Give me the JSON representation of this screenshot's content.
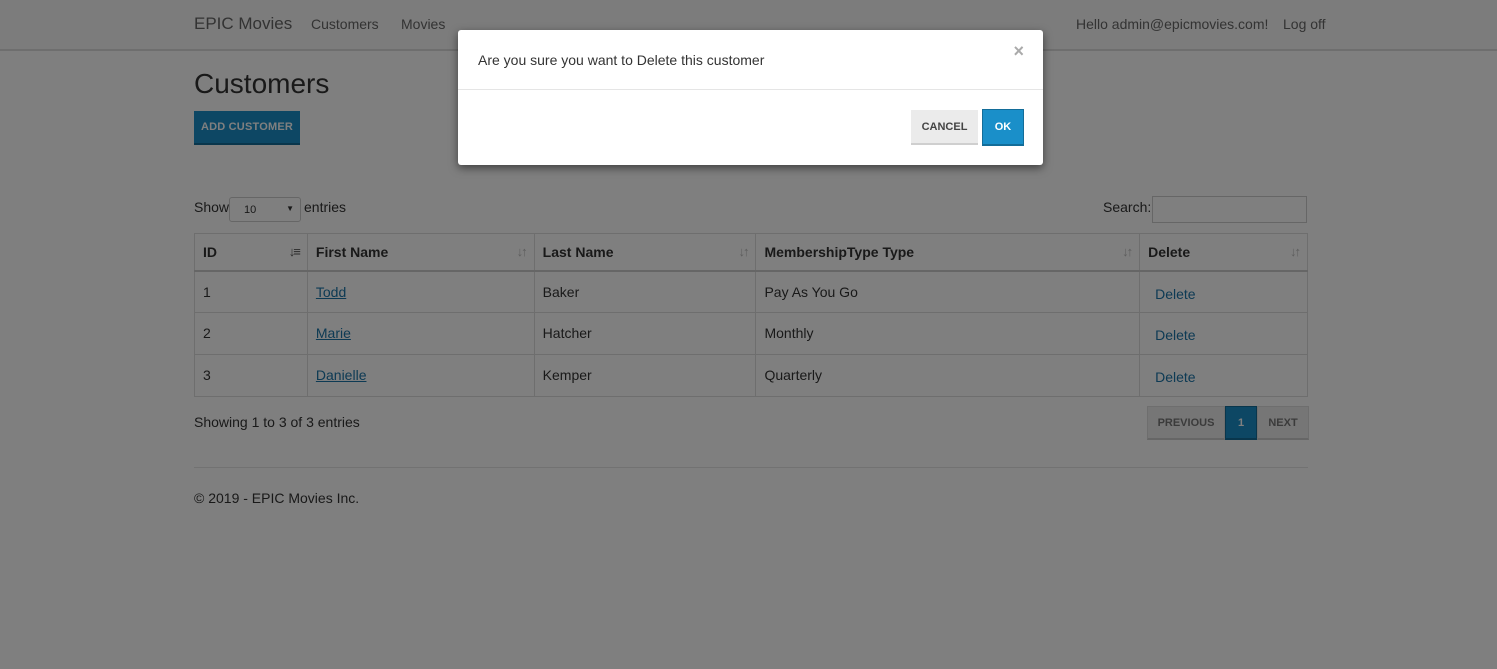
{
  "navbar": {
    "brand": "EPIC Movies",
    "links": [
      "Customers",
      "Movies"
    ],
    "greeting": "Hello admin@epicmovies.com!",
    "logoff": "Log off"
  },
  "page": {
    "title": "Customers",
    "add_button": "ADD CUSTOMER"
  },
  "datatable": {
    "show_label": "Show",
    "page_length": "10",
    "entries_label": "entries",
    "search_label": "Search:",
    "search_value": "",
    "columns": [
      "ID",
      "First Name",
      "Last Name",
      "MembershipType Type",
      "Delete"
    ],
    "rows": [
      {
        "id": "1",
        "first_name": "Todd",
        "last_name": "Baker",
        "membership": "Pay As You Go",
        "delete": "Delete"
      },
      {
        "id": "2",
        "first_name": "Marie",
        "last_name": "Hatcher",
        "membership": "Monthly",
        "delete": "Delete"
      },
      {
        "id": "3",
        "first_name": "Danielle",
        "last_name": "Kemper",
        "membership": "Quarterly",
        "delete": "Delete"
      }
    ],
    "info": "Showing 1 to 3 of 3 entries",
    "pager": {
      "previous": "PREVIOUS",
      "current": "1",
      "next": "NEXT"
    }
  },
  "footer": {
    "text": "© 2019 - EPIC Movies Inc."
  },
  "modal": {
    "message": "Are you sure you want to Delete this customer",
    "close": "×",
    "cancel": "CANCEL",
    "ok": "OK"
  },
  "colors": {
    "accent": "#1a8fc9",
    "backdrop": "rgba(0,0,0,0.5)"
  },
  "icons": {
    "sort": "sort-icon",
    "sort_active": "sort-asc-icon",
    "close": "close-icon",
    "caret": "caret-down-icon"
  }
}
